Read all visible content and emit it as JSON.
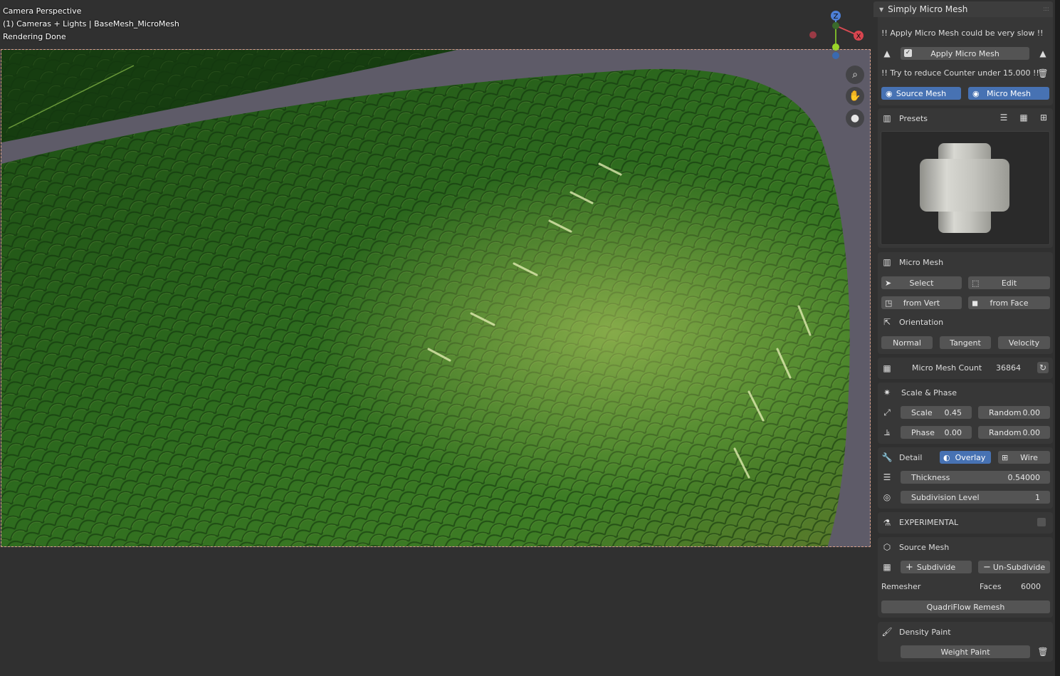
{
  "viewport": {
    "camera_label": "Camera Perspective",
    "scene_label": "(1) Cameras + Lights | BaseMesh_MicroMesh",
    "status_label": "Rendering Done",
    "gizmo": {
      "z": "Z",
      "x": "X"
    }
  },
  "panel": {
    "title": "Simply Micro Mesh",
    "warning_slow": "!! Apply Micro Mesh could be very slow !!",
    "apply_button": "Apply Micro Mesh",
    "apply_checked": true,
    "warning_counter": "!! Try to reduce Counter under 15.000 !!",
    "source_mesh_toggle": "Source Mesh",
    "micro_mesh_toggle": "Micro Mesh",
    "presets": {
      "label": "Presets"
    },
    "micro_mesh": {
      "label": "Micro Mesh",
      "select": "Select",
      "edit": "Edit",
      "from_vert": "from Vert",
      "from_face": "from Face",
      "orientation": "Orientation",
      "normal": "Normal",
      "tangent": "Tangent",
      "velocity": "Velocity"
    },
    "count": {
      "label": "Micro Mesh Count",
      "value": "36864"
    },
    "scale_phase": {
      "label": "Scale & Phase",
      "scale_label": "Scale",
      "scale_value": "0.45",
      "random1_label": "Random",
      "random1_value": "0.00",
      "phase_label": "Phase",
      "phase_value": "0.00",
      "random2_label": "Random",
      "random2_value": "0.00"
    },
    "detail": {
      "label": "Detail",
      "overlay": "Overlay",
      "wire": "Wire",
      "thickness_label": "Thickness",
      "thickness_value": "0.54000",
      "subdiv_label": "Subdivision Level",
      "subdiv_value": "1"
    },
    "experimental": {
      "label": "EXPERIMENTAL"
    },
    "source_mesh": {
      "label": "Source Mesh",
      "subdivide": "Subdivide",
      "unsubdivide": "Un-Subdivide",
      "remesher": "Remesher",
      "faces_label": "Faces",
      "faces_value": "6000",
      "quadriflow": "QuadriFlow Remesh"
    },
    "density_paint": {
      "label": "Density Paint",
      "weight_paint": "Weight Paint"
    }
  },
  "colors": {
    "accent": "#4772b3",
    "panel_bg": "#303030",
    "box_bg": "#373737",
    "button": "#545454",
    "scale_green": "#2f6a1f"
  }
}
